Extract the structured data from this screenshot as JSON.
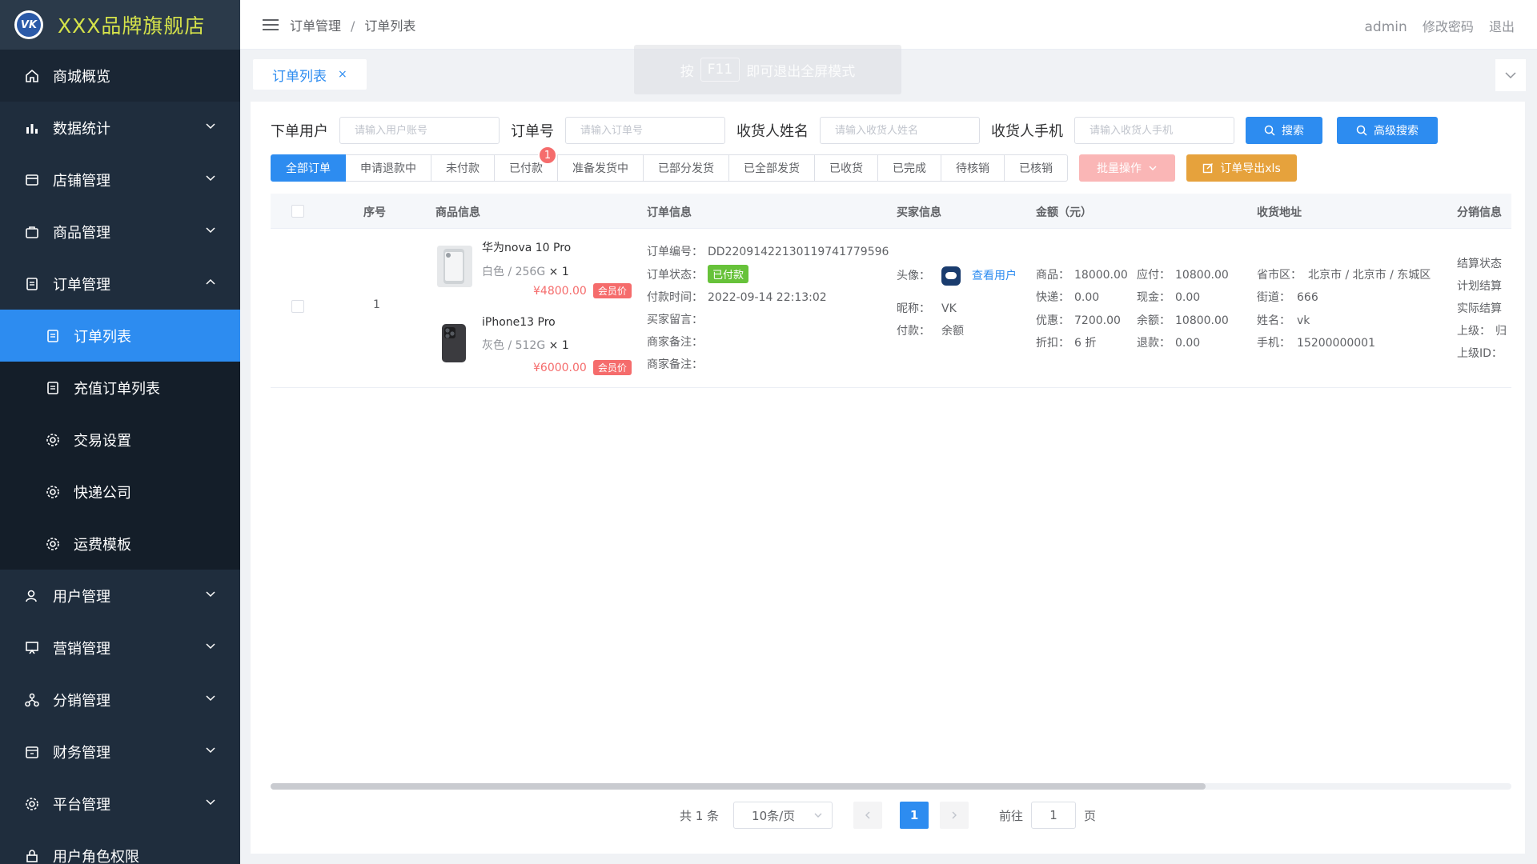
{
  "app": {
    "logo_text": "VK",
    "store_name": "XXX品牌旗舰店"
  },
  "sidebar": {
    "items": [
      {
        "label": "商城概览",
        "icon": "home-icon"
      },
      {
        "label": "数据统计",
        "icon": "bar-chart-icon"
      },
      {
        "label": "店铺管理",
        "icon": "store-icon"
      },
      {
        "label": "商品管理",
        "icon": "bag-icon"
      },
      {
        "label": "订单管理",
        "icon": "document-icon"
      }
    ],
    "sub_items": [
      {
        "label": "订单列表",
        "icon": "document-icon"
      },
      {
        "label": "充值订单列表",
        "icon": "document-icon"
      },
      {
        "label": "交易设置",
        "icon": "gear-icon"
      },
      {
        "label": "快递公司",
        "icon": "gear-icon"
      },
      {
        "label": "运费模板",
        "icon": "gear-icon"
      }
    ],
    "items_after": [
      {
        "label": "用户管理",
        "icon": "user-icon"
      },
      {
        "label": "营销管理",
        "icon": "presentation-icon"
      },
      {
        "label": "分销管理",
        "icon": "network-icon"
      },
      {
        "label": "财务管理",
        "icon": "wallet-icon"
      },
      {
        "label": "平台管理",
        "icon": "gear-icon"
      },
      {
        "label": "用户角色权限",
        "icon": "lock-icon"
      }
    ]
  },
  "header": {
    "breadcrumb": [
      "订单管理",
      "订单列表"
    ],
    "user": "admin",
    "change_password": "修改密码",
    "logout": "退出"
  },
  "fullscreen_tip": {
    "prefix": "按",
    "key": "F11",
    "suffix": "即可退出全屏模式"
  },
  "tabs": [
    {
      "label": "订单列表",
      "close": "×"
    }
  ],
  "filters": {
    "user_label": "下单用户",
    "user_placeholder": "请输入用户账号",
    "order_label": "订单号",
    "order_placeholder": "请输入订单号",
    "receiver_label": "收货人姓名",
    "receiver_placeholder": "请输入收货人姓名",
    "phone_label": "收货人手机",
    "phone_placeholder": "请输入收货人手机",
    "search_button": "搜索",
    "advanced_button": "高级搜索"
  },
  "status_tabs": [
    {
      "label": "全部订单",
      "active": true
    },
    {
      "label": "申请退款中"
    },
    {
      "label": "未付款"
    },
    {
      "label": "已付款",
      "badge": "1"
    },
    {
      "label": "准备发货中"
    },
    {
      "label": "已部分发货"
    },
    {
      "label": "已全部发货"
    },
    {
      "label": "已收货"
    },
    {
      "label": "已完成"
    },
    {
      "label": "待核销"
    },
    {
      "label": "已核销"
    }
  ],
  "actions": {
    "batch": "批量操作",
    "export": "订单导出xls"
  },
  "table": {
    "columns": [
      "序号",
      "商品信息",
      "订单信息",
      "买家信息",
      "金额（元）",
      "收货地址",
      "分销信息"
    ],
    "rows": [
      {
        "index": "1",
        "products": [
          {
            "name": "华为nova 10 Pro",
            "spec": "白色 / 256G",
            "qty": "× 1",
            "price": "¥4800.00",
            "tag": "会员价"
          },
          {
            "name": "iPhone13 Pro",
            "spec": "灰色 / 512G",
            "qty": "× 1",
            "price": "¥6000.00",
            "tag": "会员价"
          }
        ],
        "order": {
          "no_label": "订单编号：",
          "no": "DD22091422130119741779596",
          "status_label": "订单状态：",
          "status": "已付款",
          "pay_time_label": "付款时间：",
          "pay_time": "2022-09-14 22:13:02",
          "buyer_msg_label": "买家留言：",
          "merchant_note_label": "商家备注：",
          "merchant_note2_label": "商家备注："
        },
        "buyer": {
          "avatar_label": "头像：",
          "view_user": "查看用户",
          "nick_label": "昵称：",
          "nick": "VK",
          "pay_label": "付款：",
          "pay": "余额"
        },
        "amount": {
          "goods_label": "商品：",
          "goods": "18000.00",
          "payable_label": "应付：",
          "payable": "10800.00",
          "express_label": "快递：",
          "express": "0.00",
          "cash_label": "现金：",
          "cash": "0.00",
          "discount_label": "优惠：",
          "discount": "7200.00",
          "balance_label": "余额：",
          "balance": "10800.00",
          "rate_label": "折扣：",
          "rate": "6 折",
          "refund_label": "退款：",
          "refund": "0.00"
        },
        "address": {
          "region_label": "省市区：",
          "region": "北京市 / 北京市 / 东城区",
          "street_label": "街道：",
          "street": "666",
          "name_label": "姓名：",
          "name": "vk",
          "phone_label": "手机：",
          "phone": "15200000001"
        },
        "distribution": {
          "settle_status": "结算状态",
          "plan_settle": "计划结算",
          "actual_settle": "实际结算",
          "parent_label": "上级：",
          "parent": "归",
          "parent_id": "上级ID："
        }
      }
    ]
  },
  "pagination": {
    "total": "共 1 条",
    "page_size": "10条/页",
    "current": "1",
    "goto_label": "前往",
    "goto_value": "1",
    "page_unit": "页"
  },
  "colors": {
    "primary": "#2d8cf0",
    "sidebar": "#1f2d3d",
    "danger": "#f56c6c",
    "success": "#67c23a",
    "warning": "#e6a23c"
  }
}
